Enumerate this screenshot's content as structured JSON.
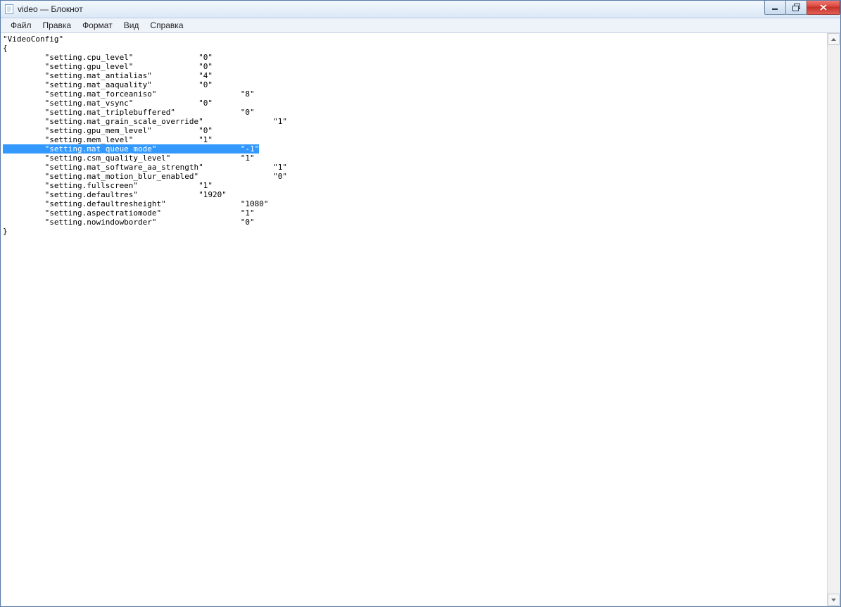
{
  "window": {
    "title": "video — Блокнот"
  },
  "menu": {
    "file": "Файл",
    "edit": "Правка",
    "format": "Формат",
    "view": "Вид",
    "help": "Справка"
  },
  "content": {
    "header": "\"VideoConfig\"",
    "open_brace": "{",
    "lines": [
      {
        "key": "setting.cpu_level",
        "colKey": 9,
        "val": "0",
        "colVal": 42,
        "sel": false
      },
      {
        "key": "setting.gpu_level",
        "colKey": 9,
        "val": "0",
        "colVal": 42,
        "sel": false
      },
      {
        "key": "setting.mat_antialias",
        "colKey": 9,
        "val": "4",
        "colVal": 42,
        "sel": false
      },
      {
        "key": "setting.mat_aaquality",
        "colKey": 9,
        "val": "0",
        "colVal": 42,
        "sel": false
      },
      {
        "key": "setting.mat_forceaniso",
        "colKey": 9,
        "val": "8",
        "colVal": 51,
        "sel": false
      },
      {
        "key": "setting.mat_vsync",
        "colKey": 9,
        "val": "0",
        "colVal": 42,
        "sel": false
      },
      {
        "key": "setting.mat_triplebuffered",
        "colKey": 9,
        "val": "0",
        "colVal": 51,
        "sel": false
      },
      {
        "key": "setting.mat_grain_scale_override",
        "colKey": 9,
        "val": "1",
        "colVal": 58,
        "sel": false
      },
      {
        "key": "setting.gpu_mem_level",
        "colKey": 9,
        "val": "0",
        "colVal": 42,
        "sel": false
      },
      {
        "key": "setting.mem_level",
        "colKey": 9,
        "val": "1",
        "colVal": 42,
        "sel": false
      },
      {
        "key": "setting.mat_queue_mode",
        "colKey": 9,
        "val": "-1",
        "colVal": 51,
        "sel": true
      },
      {
        "key": "setting.csm_quality_level",
        "colKey": 9,
        "val": "1",
        "colVal": 51,
        "sel": false
      },
      {
        "key": "setting.mat_software_aa_strength",
        "colKey": 9,
        "val": "1",
        "colVal": 58,
        "sel": false
      },
      {
        "key": "setting.mat_motion_blur_enabled",
        "colKey": 9,
        "val": "0",
        "colVal": 58,
        "sel": false
      },
      {
        "key": "setting.fullscreen",
        "colKey": 9,
        "val": "1",
        "colVal": 42,
        "sel": false
      },
      {
        "key": "setting.defaultres",
        "colKey": 9,
        "val": "1920",
        "colVal": 42,
        "sel": false
      },
      {
        "key": "setting.defaultresheight",
        "colKey": 9,
        "val": "1080",
        "colVal": 51,
        "sel": false
      },
      {
        "key": "setting.aspectratiomode",
        "colKey": 9,
        "val": "1",
        "colVal": 51,
        "sel": false
      },
      {
        "key": "setting.nowindowborder",
        "colKey": 9,
        "val": "0",
        "colVal": 51,
        "sel": false
      }
    ],
    "close_brace": "}"
  }
}
